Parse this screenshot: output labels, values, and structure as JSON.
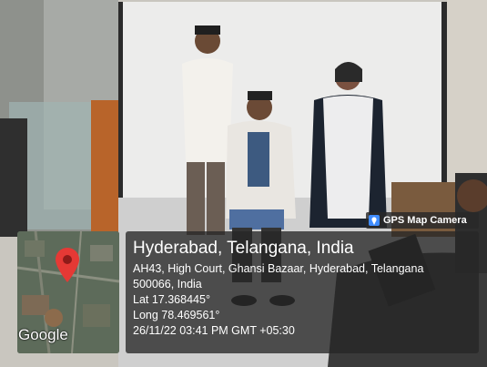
{
  "overlay": {
    "badge_label": "GPS Map Camera",
    "location_title": "Hyderabad, Telangana, India",
    "address_line1": "AH43, High Court, Ghansi Bazaar, Hyderabad, Telangana",
    "address_line2": "500066, India",
    "latitude": "Lat 17.368445°",
    "longitude": "Long 78.469561°",
    "timestamp": "26/11/22 03:41 PM GMT +05:30",
    "map_logo": "Google"
  },
  "icons": {
    "badge": "camera-pin-icon",
    "map_pin": "map-pin-icon"
  },
  "colors": {
    "overlay_bg": "#262626",
    "pin_red": "#e53935",
    "text": "#ffffff"
  }
}
